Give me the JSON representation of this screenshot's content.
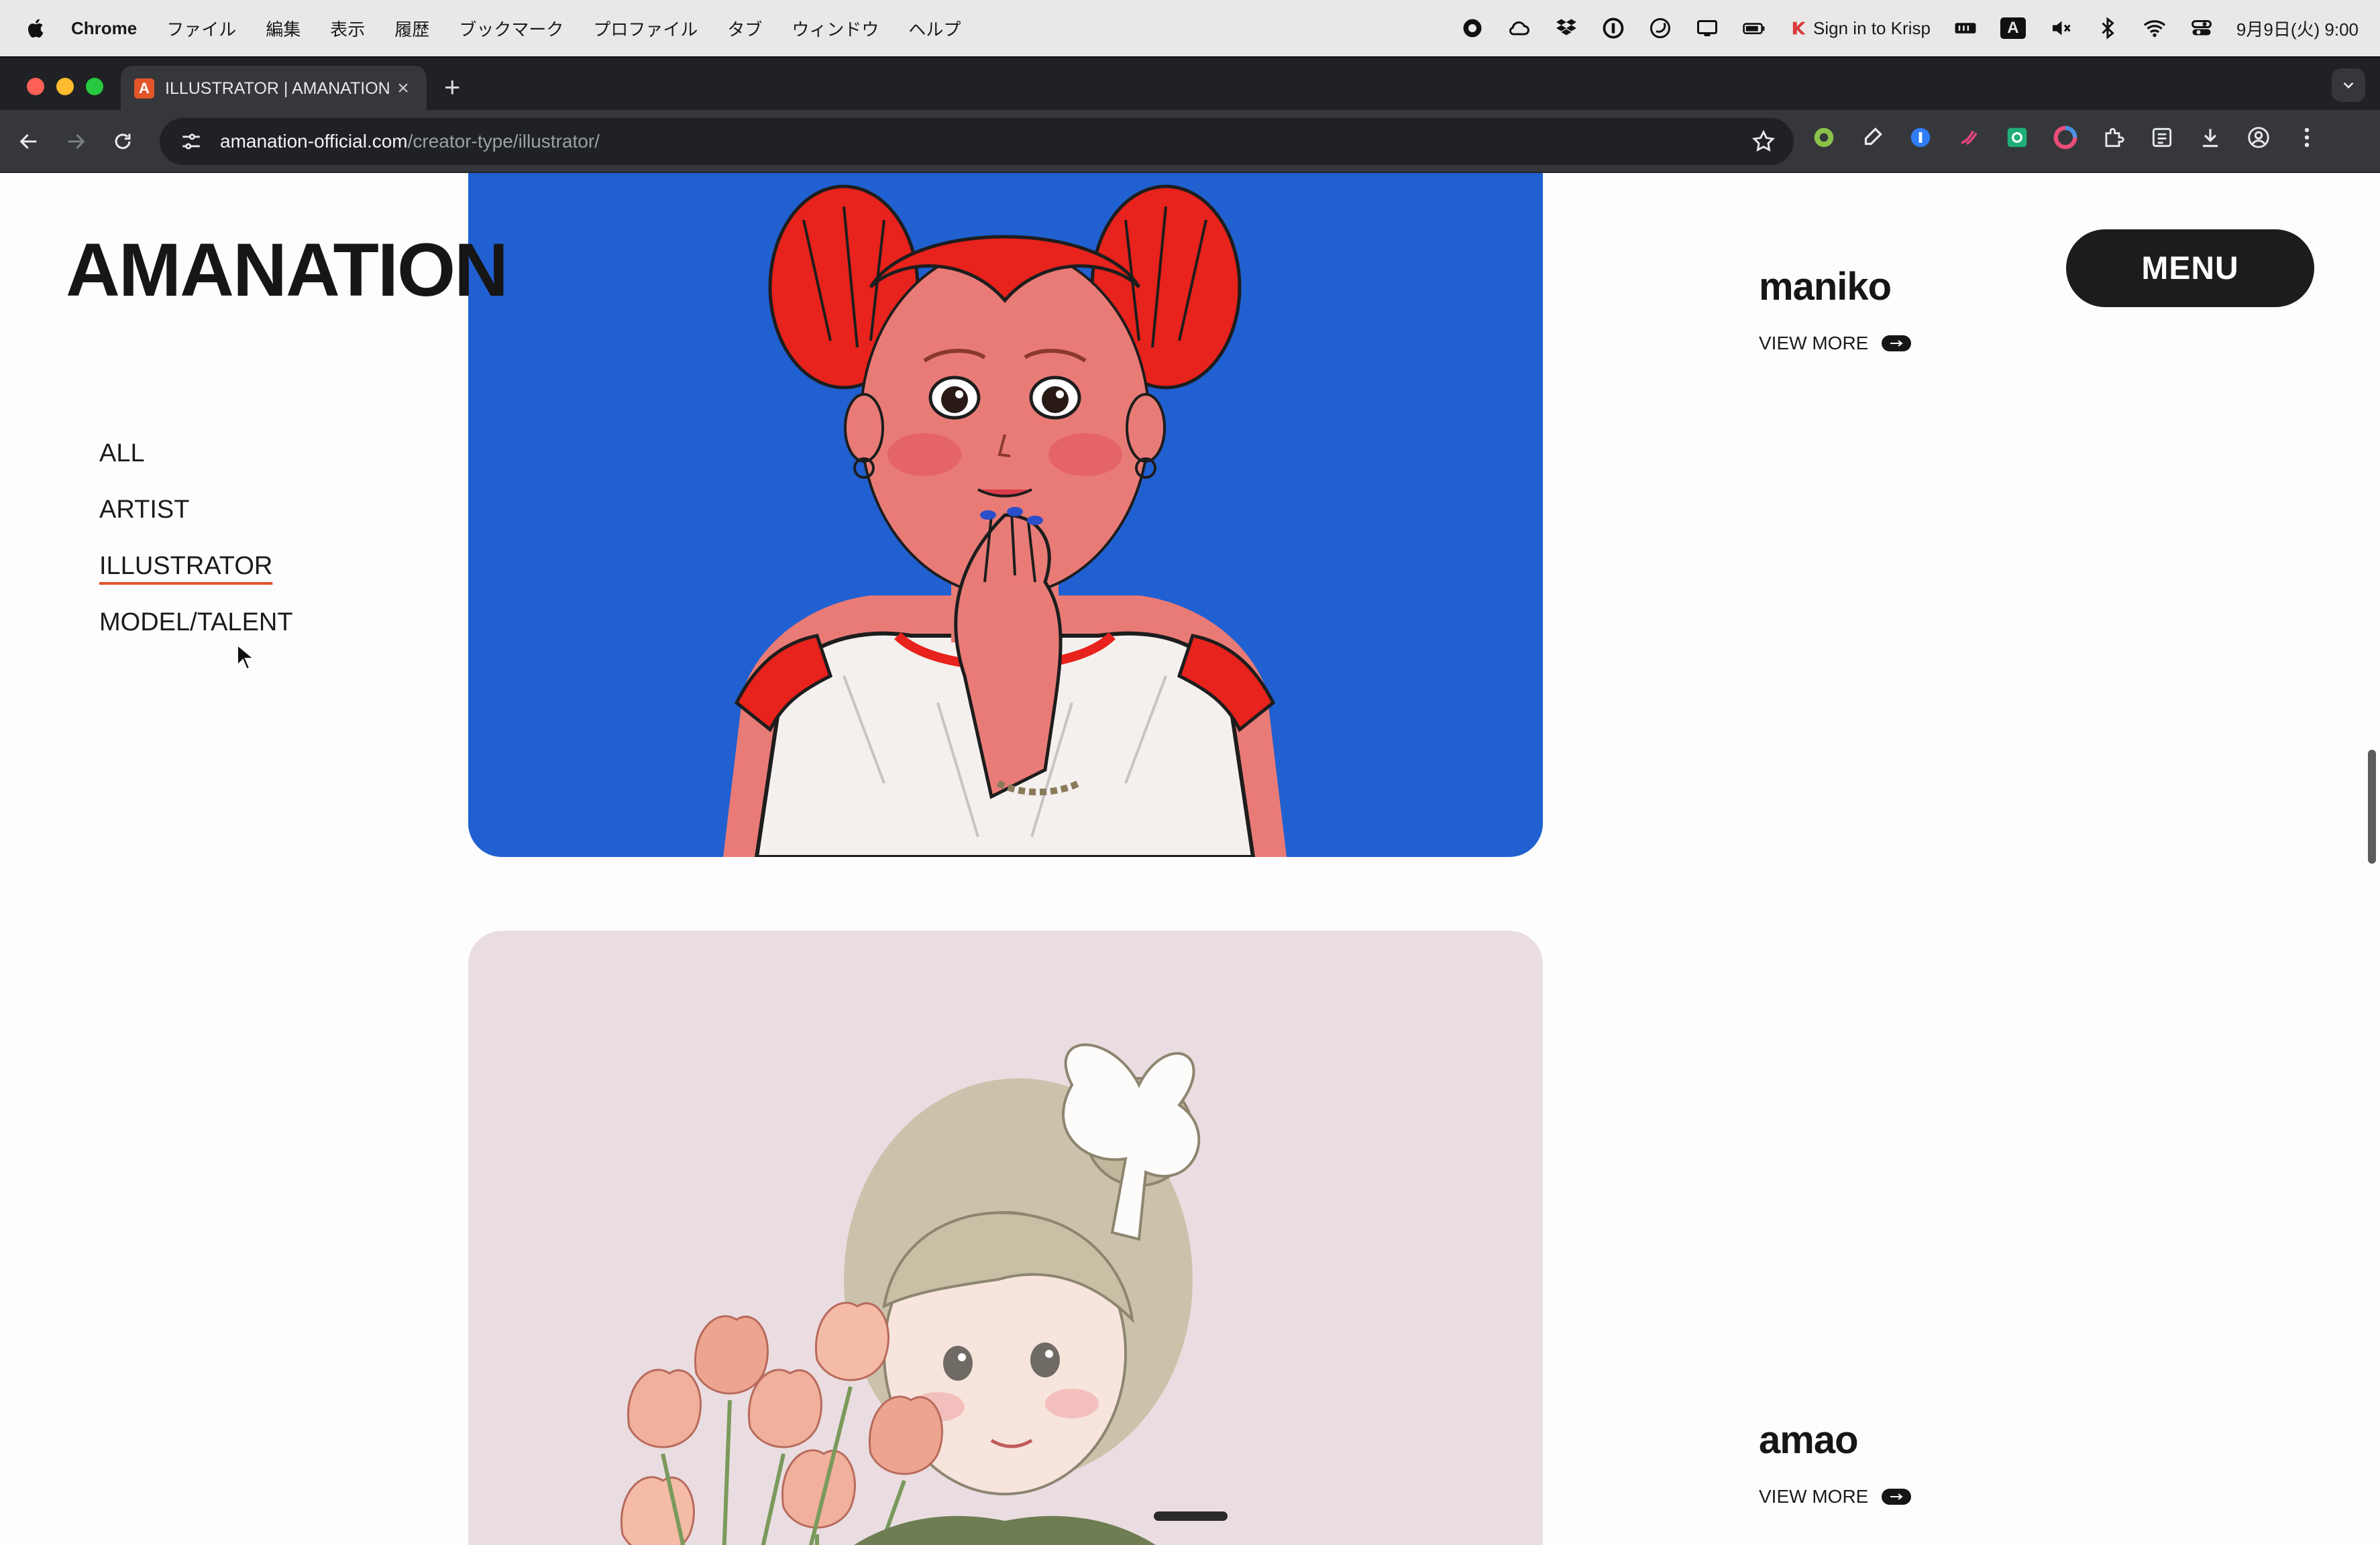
{
  "menubar": {
    "app_name": "Chrome",
    "menus": [
      "ファイル",
      "編集",
      "表示",
      "履歴",
      "ブックマーク",
      "プロファイル",
      "タブ",
      "ウィンドウ",
      "ヘルプ"
    ],
    "krisp_label": "Sign in to Krisp",
    "input_indicator": "A",
    "datetime": "9月9日(火) 9:00"
  },
  "browser": {
    "tab_title": "ILLUSTRATOR | AMANATION",
    "tab_favicon_letter": "A",
    "new_tab_symbol": "+",
    "tab_close_symbol": "×",
    "url_host": "amanation-official.com",
    "url_path": "/creator-type/illustrator/"
  },
  "site": {
    "logo": "AMANATION",
    "menu_button": "MENU",
    "categories": [
      {
        "label": "ALL",
        "active": false
      },
      {
        "label": "ARTIST",
        "active": false
      },
      {
        "label": "ILLUSTRATOR",
        "active": true
      },
      {
        "label": "MODEL/TALENT",
        "active": false
      }
    ],
    "creators": [
      {
        "name": "maniko",
        "link": "VIEW MORE"
      },
      {
        "name": "amao",
        "link": "VIEW MORE"
      }
    ]
  },
  "colors": {
    "accent_underline": "#e0542a",
    "card1_bg": "#2160d0",
    "card2_bg": "#eadde1",
    "menu_button_bg": "#1c1c1c"
  }
}
